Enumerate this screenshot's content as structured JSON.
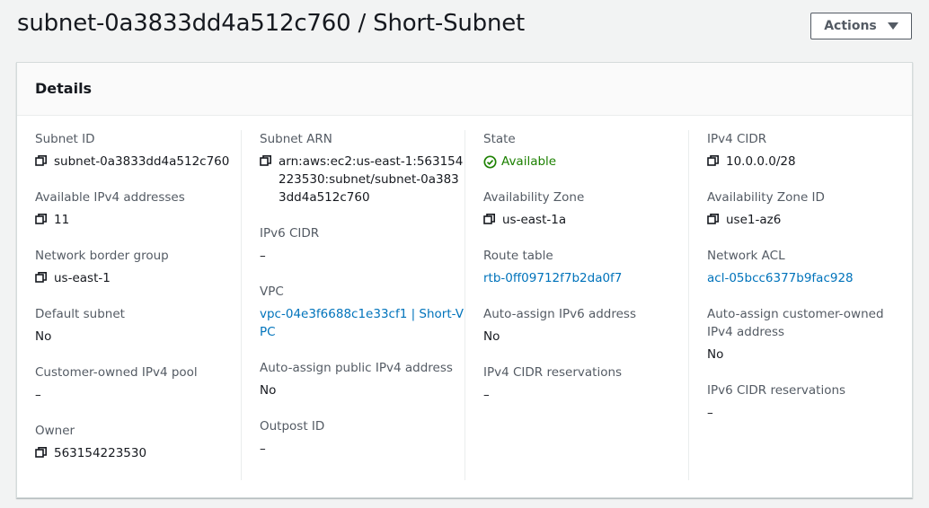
{
  "header": {
    "title": "subnet-0a3833dd4a512c760 / Short-Subnet",
    "actions_label": "Actions"
  },
  "panel": {
    "title": "Details"
  },
  "colors": {
    "link": "#0073bb",
    "available": "#1d8102",
    "label": "#545b64"
  },
  "columns": [
    {
      "fields": [
        {
          "label": "Subnet ID",
          "value": "subnet-0a3833dd4a512c760",
          "copy": true
        },
        {
          "label": "Available IPv4 addresses",
          "value": "11",
          "copy": true
        },
        {
          "label": "Network border group",
          "value": "us-east-1",
          "copy": true
        },
        {
          "label": "Default subnet",
          "value": "No"
        },
        {
          "label": "Customer-owned IPv4 pool",
          "value": "–"
        },
        {
          "label": "Owner",
          "value": "563154223530",
          "copy": true
        }
      ]
    },
    {
      "fields": [
        {
          "label": "Subnet ARN",
          "value": "arn:aws:ec2:us-east-1:563154223530:subnet/subnet-0a3833dd4a512c760",
          "copy": true
        },
        {
          "label": "IPv6 CIDR",
          "value": "–"
        },
        {
          "label": "VPC",
          "value": "vpc-04e3f6688c1e33cf1 | Short-VPC",
          "link": true
        },
        {
          "label": "Auto-assign public IPv4 address",
          "value": "No"
        },
        {
          "label": "Outpost ID",
          "value": "–"
        }
      ]
    },
    {
      "fields": [
        {
          "label": "State",
          "value": "Available",
          "status": "success"
        },
        {
          "label": "Availability Zone",
          "value": "us-east-1a",
          "copy": true
        },
        {
          "label": "Route table",
          "value": "rtb-0ff09712f7b2da0f7",
          "link": true
        },
        {
          "label": "Auto-assign IPv6 address",
          "value": "No"
        },
        {
          "label": "IPv4 CIDR reservations",
          "value": "–"
        }
      ]
    },
    {
      "fields": [
        {
          "label": "IPv4 CIDR",
          "value": "10.0.0.0/28",
          "copy": true
        },
        {
          "label": "Availability Zone ID",
          "value": "use1-az6",
          "copy": true
        },
        {
          "label": "Network ACL",
          "value": "acl-05bcc6377b9fac928",
          "link": true
        },
        {
          "label": "Auto-assign customer-owned IPv4 address",
          "value": "No"
        },
        {
          "label": "IPv6 CIDR reservations",
          "value": "–"
        }
      ]
    }
  ]
}
